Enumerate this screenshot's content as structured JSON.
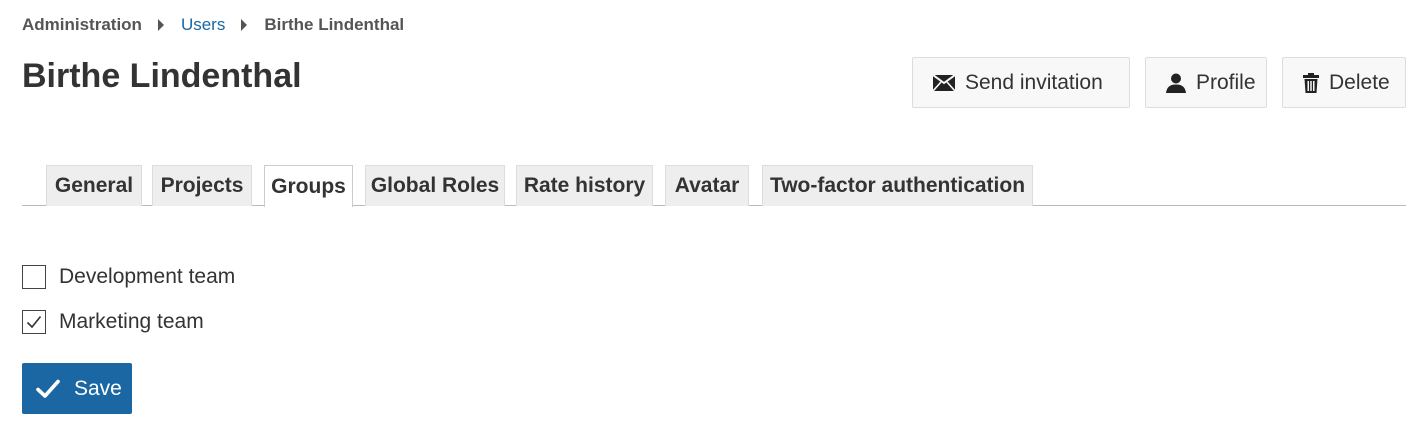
{
  "breadcrumb": {
    "items": [
      "Administration",
      "Users",
      "Birthe Lindenthal"
    ]
  },
  "page": {
    "title": "Birthe Lindenthal"
  },
  "toolbar": {
    "send_invitation_label": "Send invitation",
    "profile_label": "Profile",
    "delete_label": "Delete"
  },
  "tabs": [
    {
      "label": "General",
      "active": false
    },
    {
      "label": "Projects",
      "active": false
    },
    {
      "label": "Groups",
      "active": true
    },
    {
      "label": "Global Roles",
      "active": false
    },
    {
      "label": "Rate history",
      "active": false
    },
    {
      "label": "Avatar",
      "active": false
    },
    {
      "label": "Two-factor authentication",
      "active": false
    }
  ],
  "groups": [
    {
      "label": "Development team",
      "checked": false
    },
    {
      "label": "Marketing team",
      "checked": true
    }
  ],
  "form": {
    "save_label": "Save"
  },
  "colors": {
    "accent": "#1a67a3",
    "link": "#1a67a3",
    "text": "#333333",
    "tab_background": "#eeeeee"
  },
  "icons": {
    "send_invitation": "envelope-icon",
    "profile": "user-icon",
    "delete": "trash-icon",
    "save": "checkmark-icon",
    "breadcrumb_separator": "caret-right-icon"
  }
}
